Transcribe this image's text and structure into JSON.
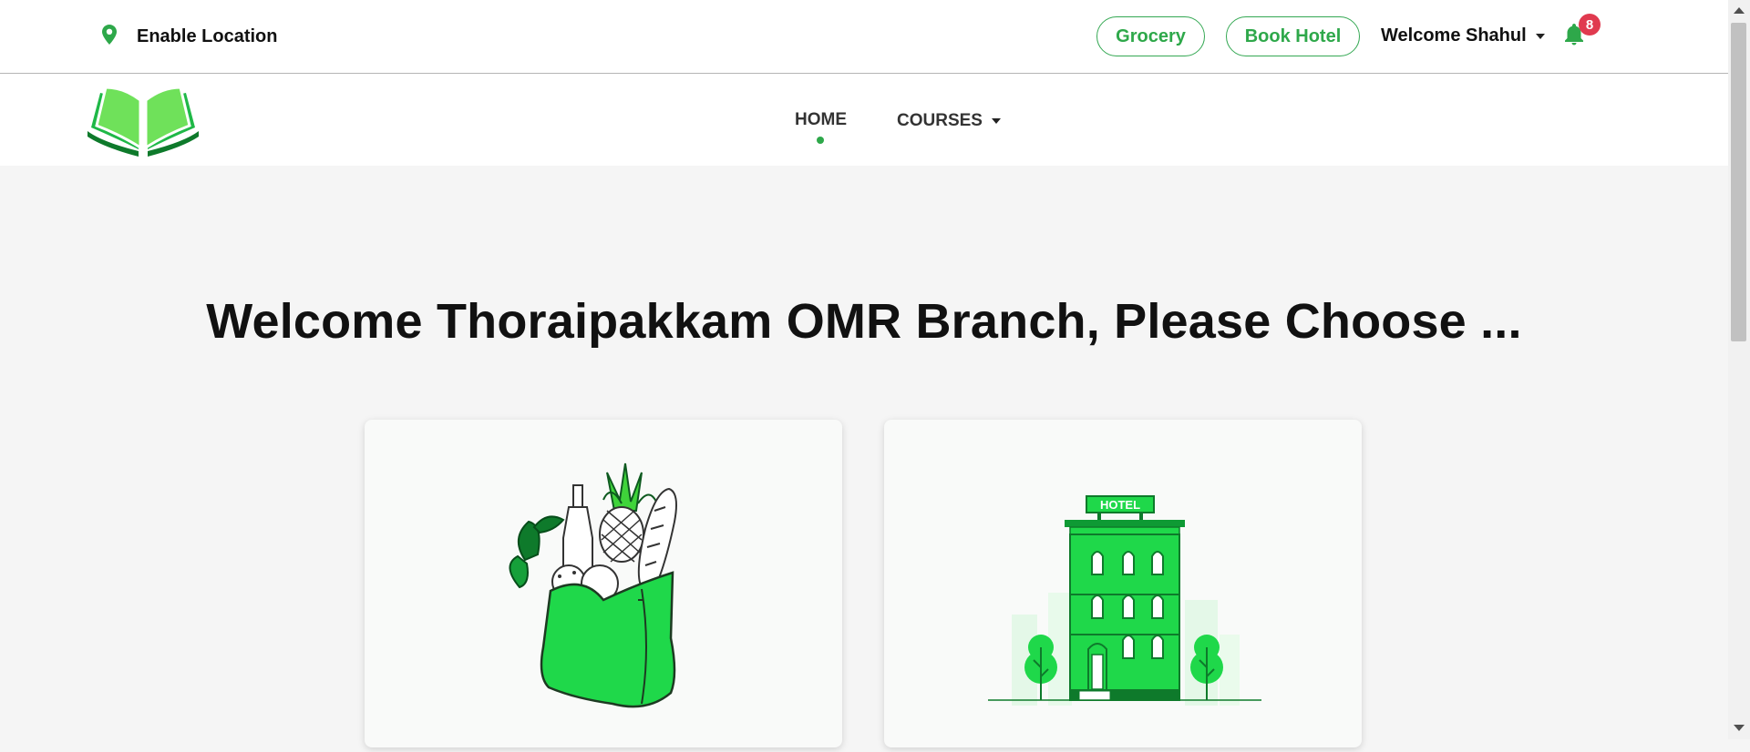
{
  "topbar": {
    "location_label": "Enable Location",
    "grocery_button": "Grocery",
    "hotel_button": "Book Hotel",
    "welcome_user": "Welcome Shahul",
    "notification_count": "8"
  },
  "nav": {
    "home": "HOME",
    "courses": "COURSES"
  },
  "main": {
    "headline": "Welcome Thoraipakkam OMR Branch, Please Choose ..."
  },
  "cards": {
    "hotel_sign": "HOTEL"
  },
  "colors": {
    "accent": "#2ea84a",
    "bright_green": "#1fd84a",
    "dark_green": "#0e7a2b",
    "badge_red": "#e03a4f"
  },
  "icons": [
    "map-pin-icon",
    "bell-icon",
    "book-logo",
    "grocery-bag-illustration",
    "hotel-illustration"
  ]
}
